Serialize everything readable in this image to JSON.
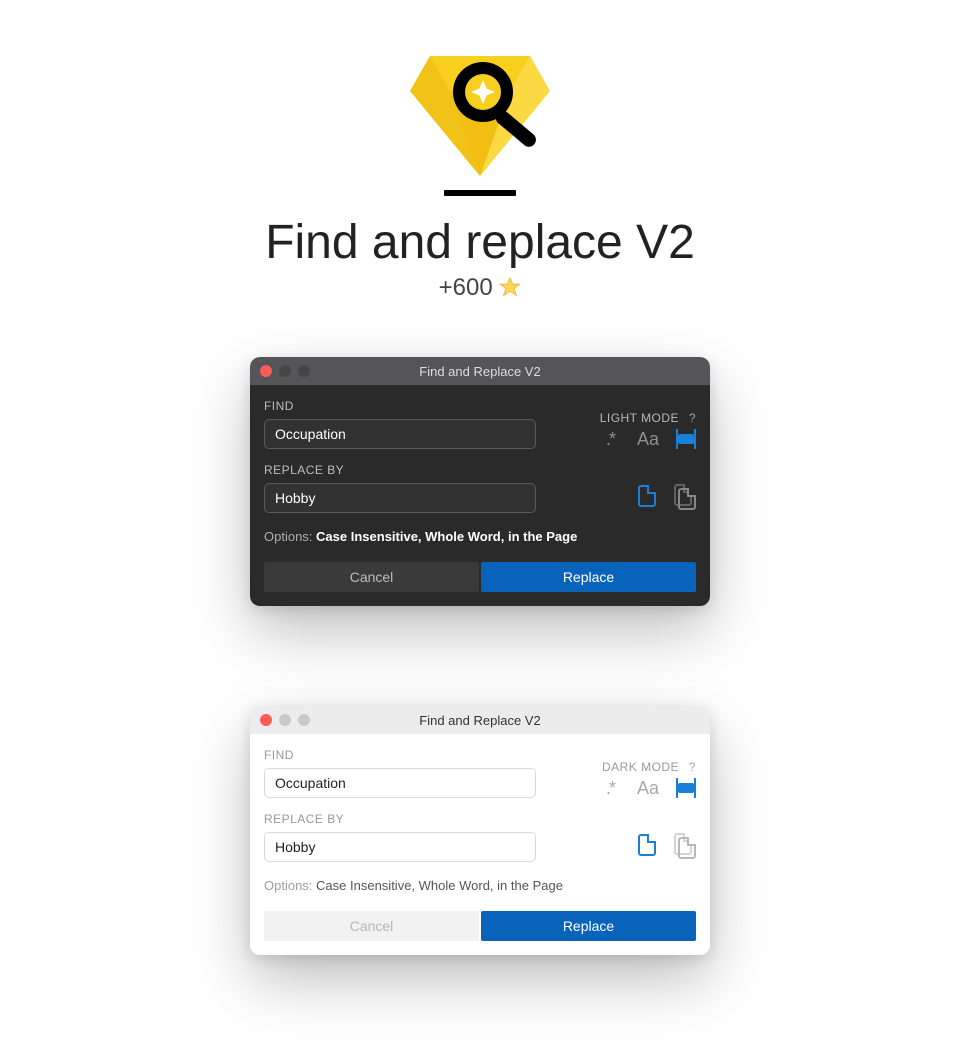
{
  "hero": {
    "title": "Find and replace V2",
    "subtitle": "+600",
    "star_icon": "star-icon"
  },
  "dark_window": {
    "title": "Find and Replace V2",
    "mode_toggle": "LIGHT MODE",
    "help": "?",
    "find_label": "FIND",
    "find_value": "Occupation",
    "replace_label": "REPLACE BY",
    "replace_value": "Hobby",
    "regex_icon_text": ".*",
    "case_icon_text": "Aa",
    "options_prefix": "Options:",
    "options_value": "Case Insensitive, Whole Word, in the Page",
    "cancel": "Cancel",
    "replace": "Replace"
  },
  "light_window": {
    "title": "Find and Replace V2",
    "mode_toggle": "DARK MODE",
    "help": "?",
    "find_label": "FIND",
    "find_value": "Occupation",
    "replace_label": "REPLACE BY",
    "replace_value": "Hobby",
    "regex_icon_text": ".*",
    "case_icon_text": "Aa",
    "options_prefix": "Options:",
    "options_value": "Case Insensitive, Whole Word, in the Page",
    "cancel": "Cancel",
    "replace": "Replace"
  }
}
